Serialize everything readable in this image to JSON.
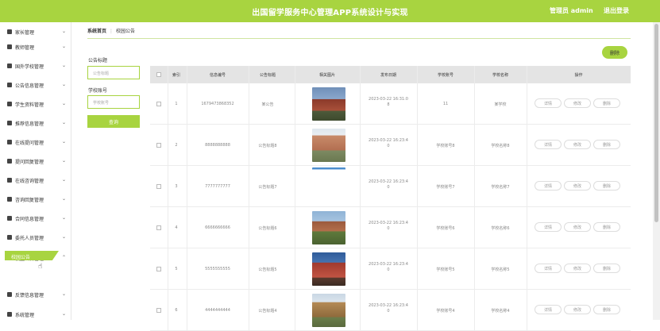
{
  "header": {
    "title": "出国留学服务中心管理APP系统设计与实现",
    "user": "管理员 admin",
    "logout": "退出登录"
  },
  "sidebar": {
    "items": [
      {
        "label": "家长管理",
        "icon": "user-icon"
      },
      {
        "label": "教师管理",
        "icon": "grid-icon"
      },
      {
        "label": "国外学校管理",
        "icon": "grid-icon"
      },
      {
        "label": "公告信息管理",
        "icon": "monitor-icon"
      },
      {
        "label": "学生资料管理",
        "icon": "grid-icon"
      },
      {
        "label": "推荐信息管理",
        "icon": "doc-icon"
      },
      {
        "label": "在线提问管理",
        "icon": "doc-icon"
      },
      {
        "label": "提问回复管理",
        "icon": "doc-icon"
      },
      {
        "label": "在线咨询管理",
        "icon": "grid-icon"
      },
      {
        "label": "咨询回复管理",
        "icon": "doc-icon"
      },
      {
        "label": "合同信息管理",
        "icon": "doc-icon"
      },
      {
        "label": "委托人员管理",
        "icon": "sliders-icon"
      },
      {
        "label": "校园公告管理",
        "icon": "pin-icon"
      },
      {
        "label": "反馈信息管理",
        "icon": "grid-icon"
      },
      {
        "label": "系统管理",
        "icon": "grid-icon"
      }
    ],
    "active_sub": "校园公告"
  },
  "breadcrumb": {
    "home": "系统首页",
    "current": "校园公告"
  },
  "filters": {
    "title_label": "公告标题",
    "title_placeholder": "公告标题",
    "account_label": "学校账号",
    "account_placeholder": "学校账号",
    "search_label": "查询"
  },
  "toolbar": {
    "delete_label": "删除"
  },
  "table": {
    "columns": [
      "索引",
      "信息编号",
      "公告标题",
      "相关图片",
      "发布日期",
      "学校账号",
      "学校名称",
      "操作"
    ],
    "actions": [
      "详情",
      "修改",
      "删除"
    ],
    "rows": [
      {
        "index": "1",
        "code": "1679473868352",
        "title": "某公告",
        "date1": "2023-03-22 16:31:0",
        "date2": "8",
        "account": "11",
        "school": "某学校"
      },
      {
        "index": "2",
        "code": "8888888888",
        "title": "公告标题8",
        "date1": "2023-03-22 16:23:4",
        "date2": "0",
        "account": "学校账号8",
        "school": "学校名称8"
      },
      {
        "index": "3",
        "code": "7777777777",
        "title": "公告标题7",
        "date1": "2023-03-22 16:23:4",
        "date2": "0",
        "account": "学校账号7",
        "school": "学校名称7"
      },
      {
        "index": "4",
        "code": "6666666666",
        "title": "公告标题6",
        "date1": "2023-03-22 16:23:4",
        "date2": "0",
        "account": "学校账号6",
        "school": "学校名称6"
      },
      {
        "index": "5",
        "code": "5555555555",
        "title": "公告标题5",
        "date1": "2023-03-22 16:23:4",
        "date2": "0",
        "account": "学校账号5",
        "school": "学校名称5"
      },
      {
        "index": "6",
        "code": "4444444444",
        "title": "公告标题4",
        "date1": "2023-03-22 16:23:4",
        "date2": "0",
        "account": "学校账号4",
        "school": "学校名称4"
      }
    ]
  },
  "colors": {
    "accent": "#a8d440"
  }
}
